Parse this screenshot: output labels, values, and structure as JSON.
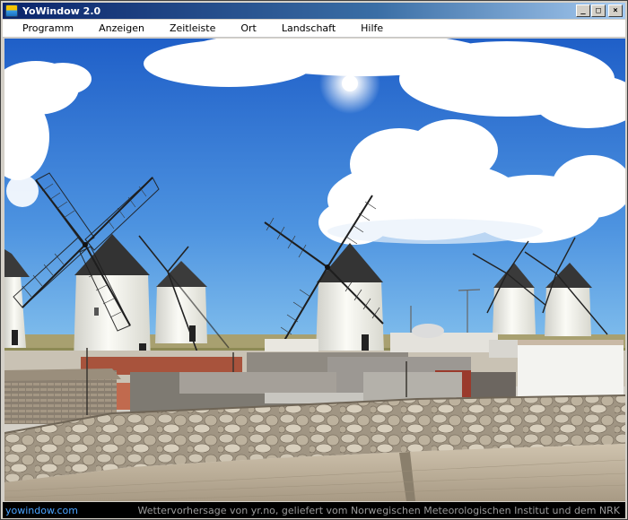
{
  "window": {
    "title": "YoWindow 2.0",
    "icon": "yowindow-app-icon",
    "controls": {
      "minimize": "_",
      "maximize": "□",
      "close": "×"
    }
  },
  "menu": {
    "items": [
      "Programm",
      "Anzeigen",
      "Zeitleiste",
      "Ort",
      "Landschaft",
      "Hilfe"
    ]
  },
  "scene": {
    "description_icon": "windmill-landscape",
    "sky_top": "#1f5fc8",
    "sky_bottom": "#7cc0ec"
  },
  "status": {
    "left": "yowindow.com",
    "right": "Wettervorhersage von yr.no, geliefert vom Norwegischen Meteorologischen Institut und dem NRK"
  }
}
